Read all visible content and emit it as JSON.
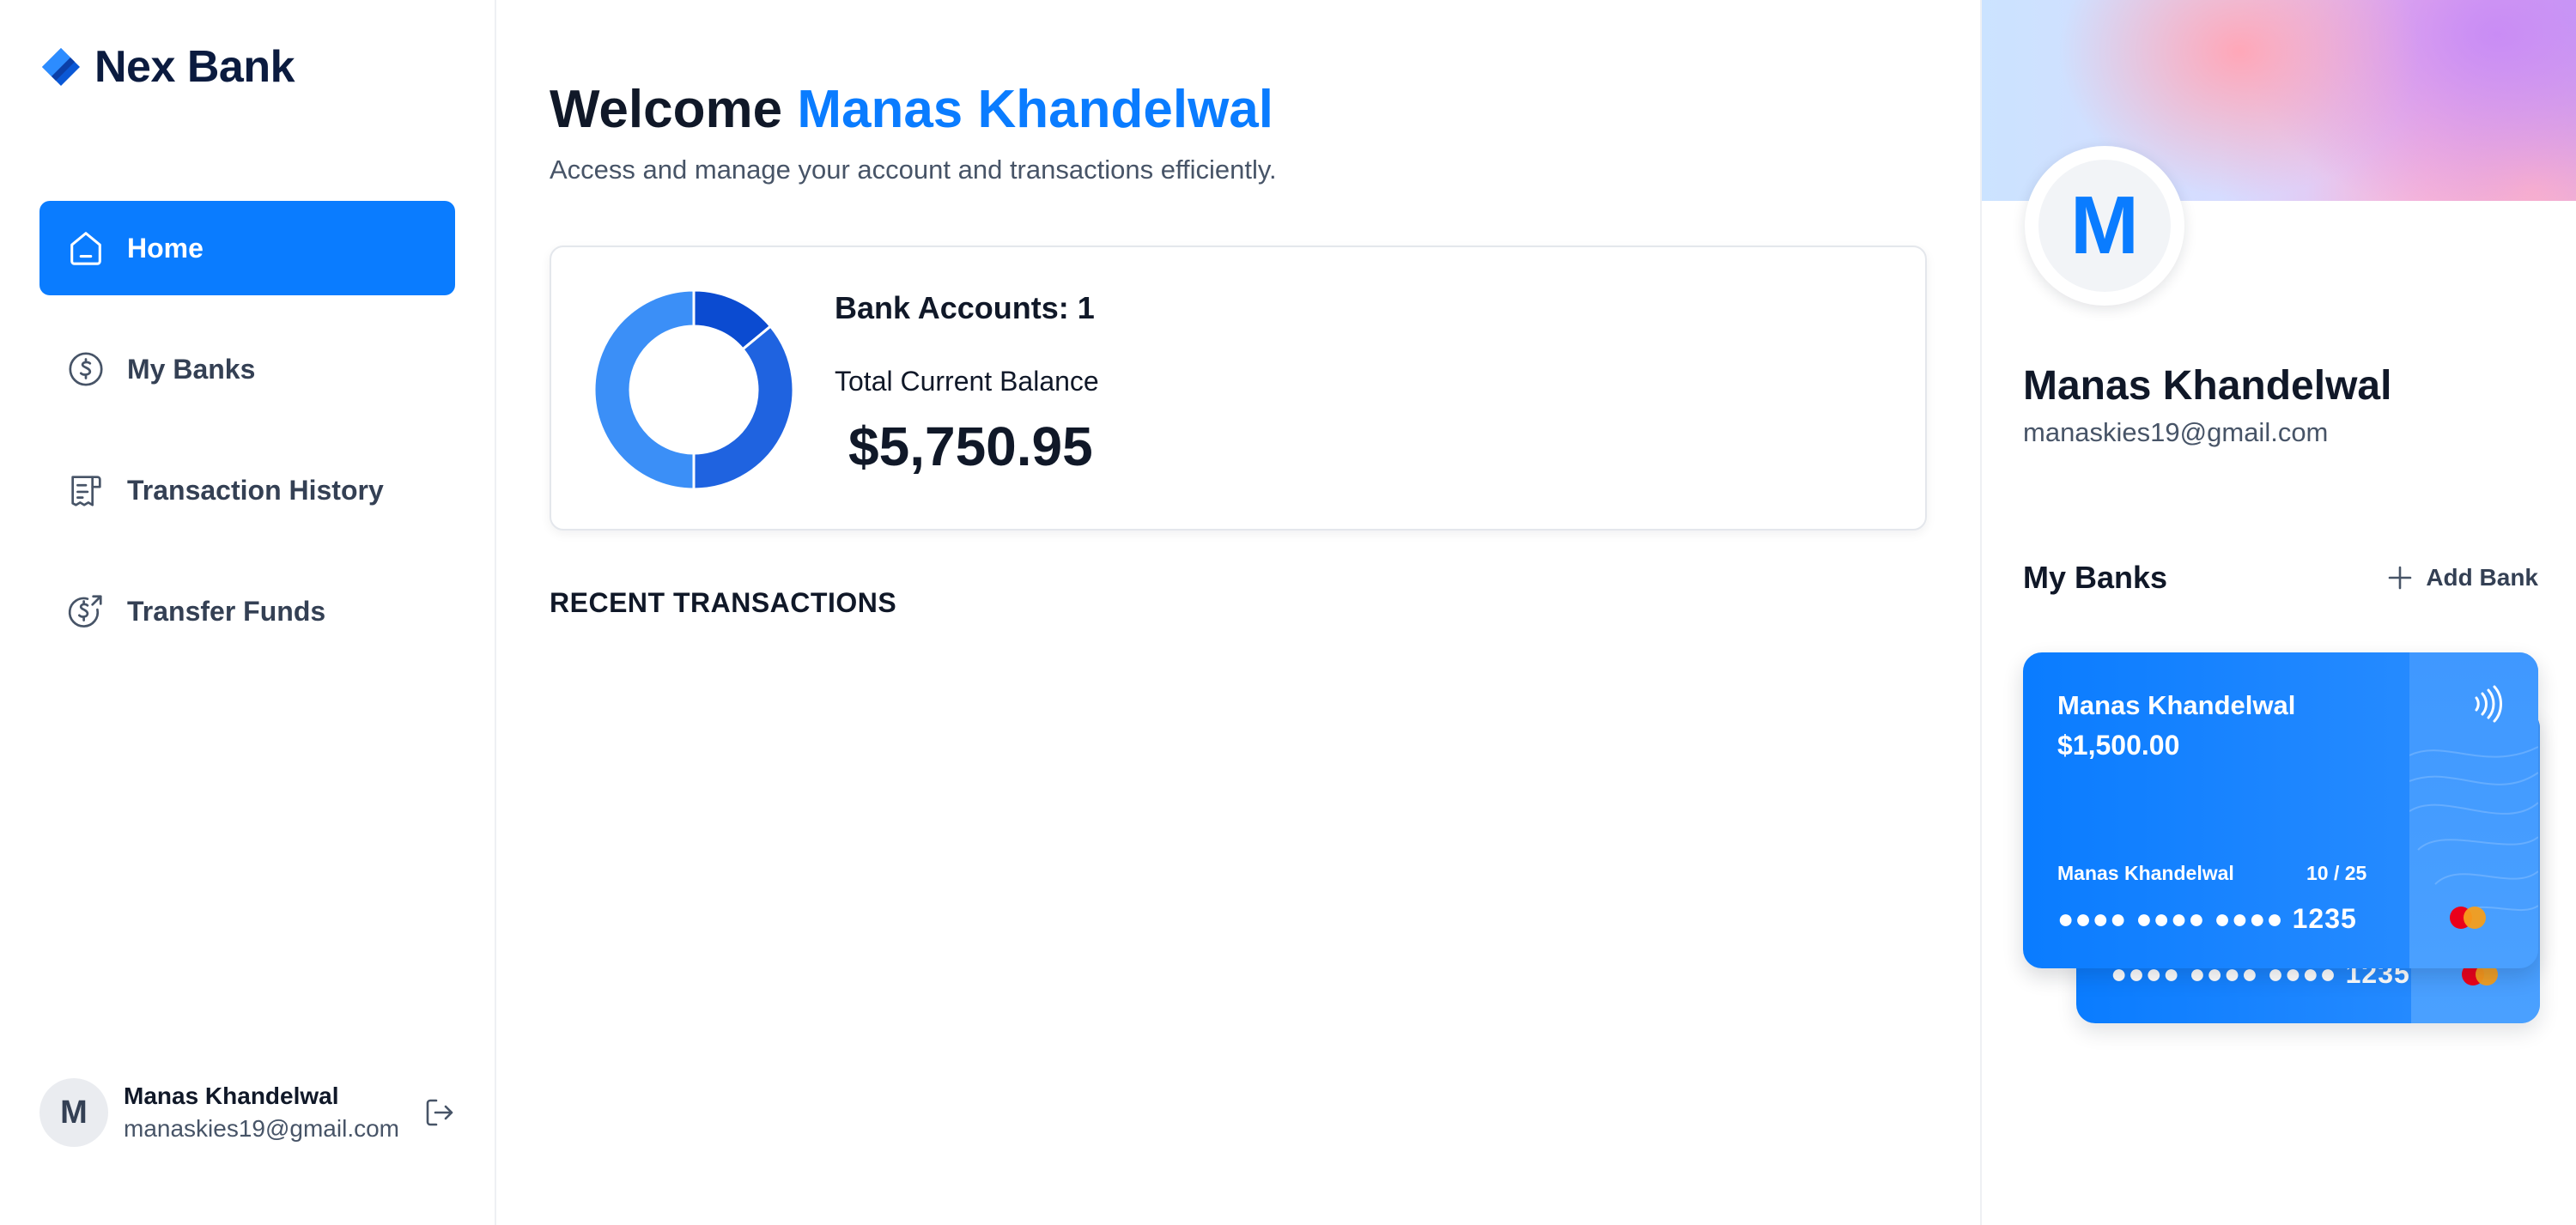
{
  "app": {
    "name": "Nex Bank",
    "accent": "#0a7cff"
  },
  "sidebar": {
    "items": [
      {
        "label": "Home",
        "icon": "home-icon",
        "active": true
      },
      {
        "label": "My Banks",
        "icon": "dollar-circle-icon",
        "active": false
      },
      {
        "label": "Transaction History",
        "icon": "receipt-icon",
        "active": false
      },
      {
        "label": "Transfer Funds",
        "icon": "money-send-icon",
        "active": false
      }
    ],
    "footer": {
      "initial": "M",
      "name": "Manas Khandelwal",
      "email": "manaskies19@gmail.com",
      "logout_icon": "logout-icon"
    }
  },
  "main": {
    "welcome_prefix": "Welcome",
    "welcome_name": "Manas Khandelwal",
    "subtitle": "Access and manage your account and transactions efficiently.",
    "summary": {
      "accounts_text": "Bank Accounts: 1",
      "balance_label": "Total Current Balance",
      "balance_value": "$5,750.95",
      "donut_segments": [
        {
          "value": 0.14,
          "color": "#0b4bd1"
        },
        {
          "value": 0.36,
          "color": "#1f63e0"
        },
        {
          "value": 0.5,
          "color": "#3b8ff7"
        }
      ]
    },
    "recent_title": "RECENT TRANSACTIONS"
  },
  "right": {
    "initial": "M",
    "name": "Manas Khandelwal",
    "email": "manaskies19@gmail.com",
    "mybanks_title": "My Banks",
    "add_bank": "Add Bank",
    "cards": [
      {
        "holder": "Manas Khandelwal",
        "balance": "$1,500.00",
        "expiry": "10 / 25",
        "number": "●●●● ●●●● ●●●● 1235"
      },
      {
        "number": "●●●● ●●●● ●●●● 1235"
      }
    ]
  }
}
